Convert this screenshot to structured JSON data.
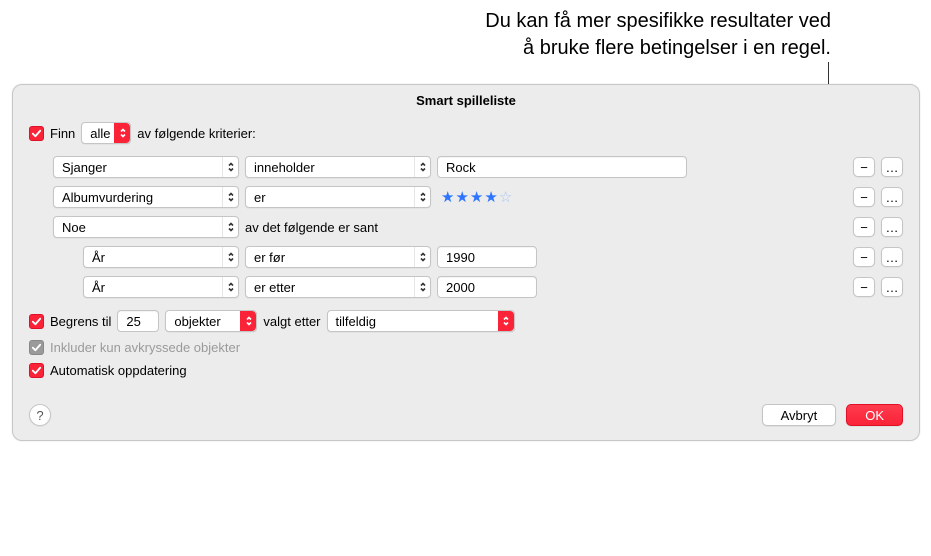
{
  "annotation": {
    "line1": "Du kan få mer spesifikke resultater ved",
    "line2": "å bruke flere betingelser i en regel."
  },
  "dialog": {
    "title": "Smart spilleliste"
  },
  "match": {
    "label_prefix": "Finn",
    "selector": "alle",
    "label_suffix": "av følgende kriterier:"
  },
  "rules": [
    {
      "field": "Sjanger",
      "op": "inneholder",
      "value": "Rock",
      "kind": "text"
    },
    {
      "field": "Albumvurdering",
      "op": "er",
      "stars_filled": 4,
      "stars_total": 5,
      "kind": "stars"
    },
    {
      "field": "Noe",
      "op_text": "av det følgende er sant",
      "kind": "group",
      "children": [
        {
          "field": "År",
          "op": "er før",
          "value": "1990",
          "kind": "text"
        },
        {
          "field": "År",
          "op": "er etter",
          "value": "2000",
          "kind": "text"
        }
      ]
    }
  ],
  "limit": {
    "label": "Begrens til",
    "value": "25",
    "unit": "objekter",
    "by_label": "valgt etter",
    "by_value": "tilfeldig"
  },
  "only_checked": {
    "label": "Inkluder kun avkryssede objekter"
  },
  "live_update": {
    "label": "Automatisk oppdatering"
  },
  "footer": {
    "cancel": "Avbryt",
    "ok": "OK"
  },
  "icons": {
    "minus": "−",
    "more": "…",
    "help": "?"
  }
}
